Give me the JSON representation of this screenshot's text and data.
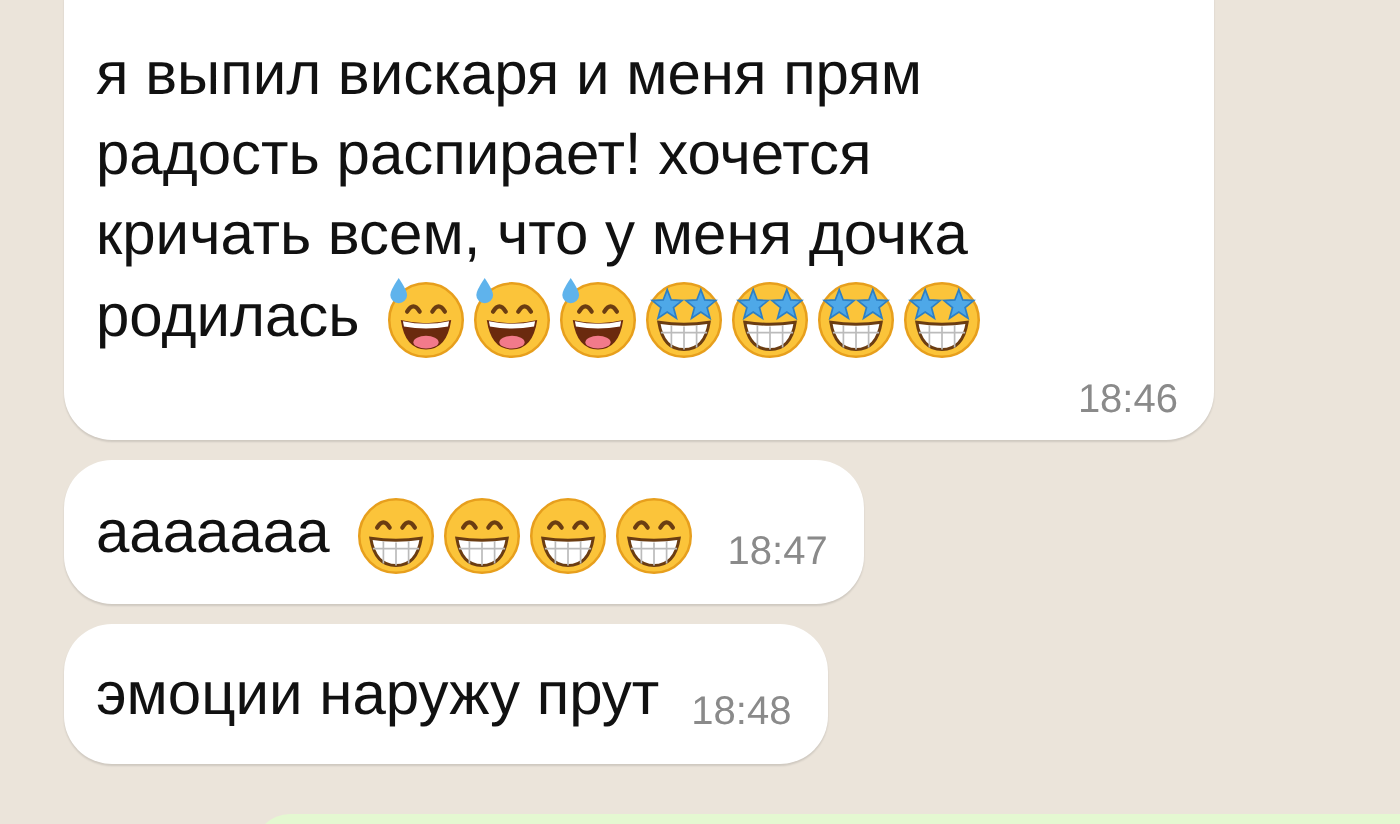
{
  "messages": [
    {
      "lines": [
        "я выпил вискаря и меня прям",
        "радость распирает! хочется",
        "кричать всем, что у меня дочка",
        "родилась"
      ],
      "emojis": [
        {
          "kind": "sweat-grin"
        },
        {
          "kind": "sweat-grin"
        },
        {
          "kind": "sweat-grin"
        },
        {
          "kind": "star-eyes"
        },
        {
          "kind": "star-eyes"
        },
        {
          "kind": "star-eyes"
        },
        {
          "kind": "star-eyes"
        }
      ],
      "time": "18:46"
    },
    {
      "lines": [
        "ааааааа"
      ],
      "emojis": [
        {
          "kind": "grin"
        },
        {
          "kind": "grin"
        },
        {
          "kind": "grin"
        },
        {
          "kind": "grin"
        }
      ],
      "time": "18:47"
    },
    {
      "lines": [
        "эмоции наружу прут"
      ],
      "time": "18:48"
    }
  ]
}
